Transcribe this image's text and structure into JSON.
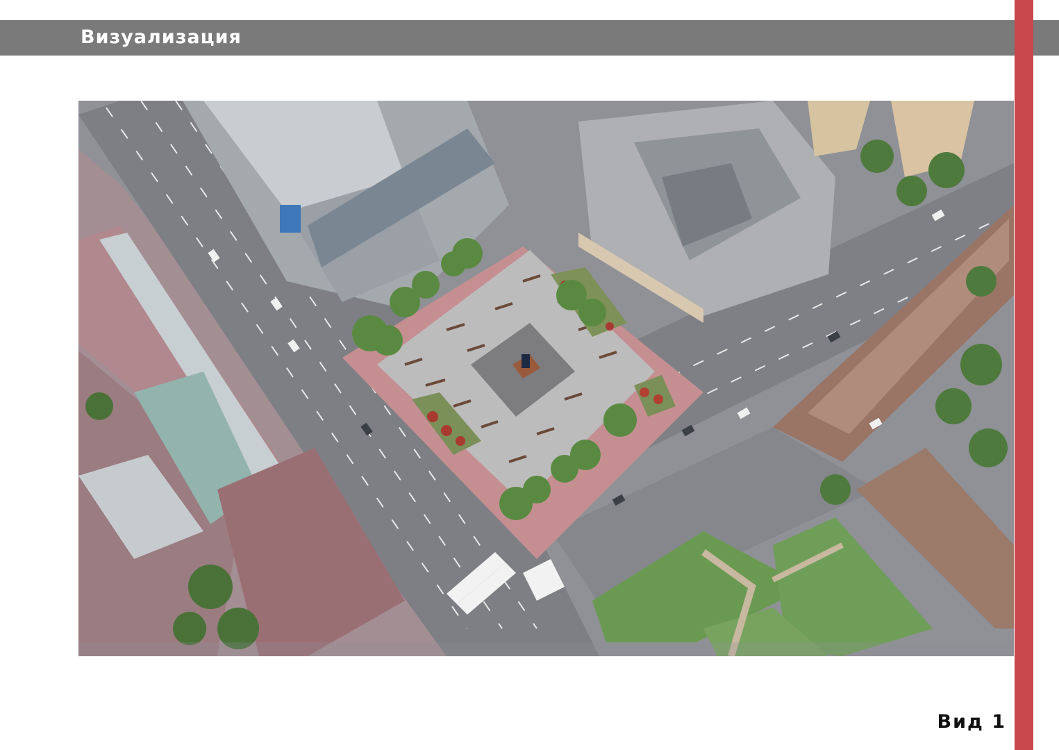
{
  "page": {
    "title": "Визуализация",
    "view_label": "Вид 1"
  },
  "colors": {
    "header_band": "#7a7a7a",
    "accent_stripe": "#c8474d",
    "background": "#ffffff"
  }
}
